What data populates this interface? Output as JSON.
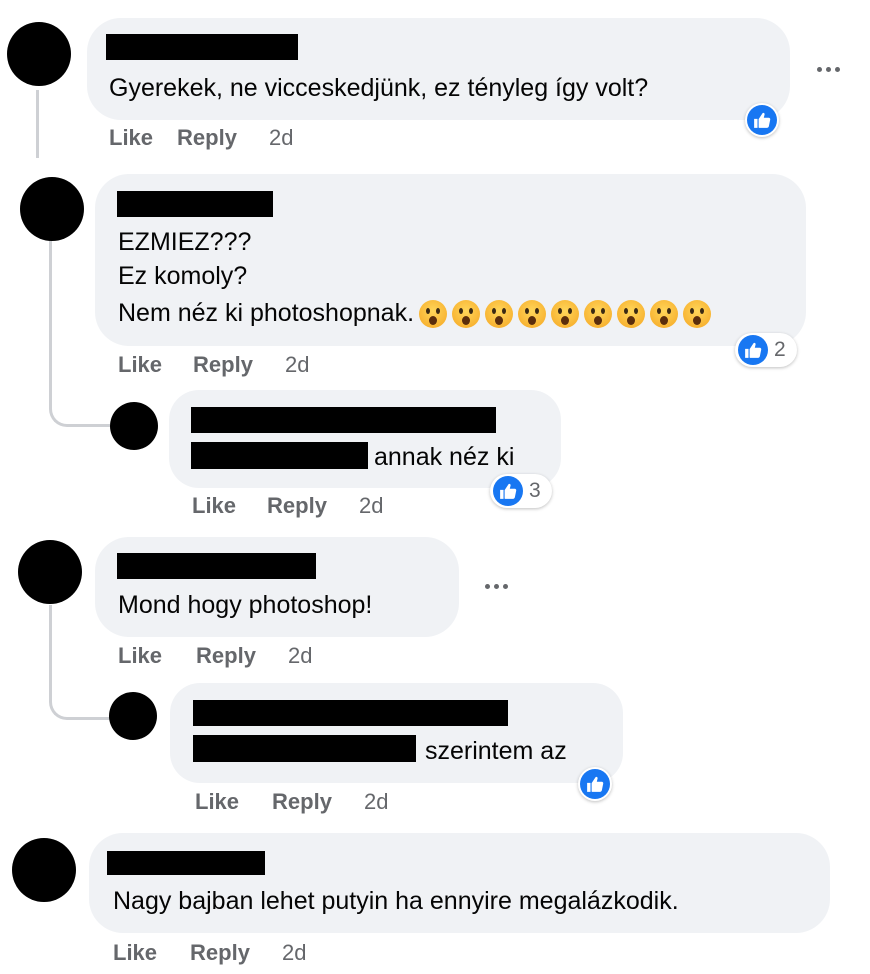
{
  "comments": [
    {
      "text": [
        "Gyerekek, ne vicceskedjünk, ez tényleg így volt?"
      ],
      "like": "Like",
      "reply": "Reply",
      "time": "2d",
      "reaction_count": ""
    },
    {
      "text": [
        "EZMIEZ???",
        "Ez komoly?",
        "Nem néz ki photoshopnak."
      ],
      "emoji_count": 9,
      "like": "Like",
      "reply": "Reply",
      "time": "2d",
      "reaction_count": "2"
    },
    {
      "text": [
        "annak néz ki"
      ],
      "like": "Like",
      "reply": "Reply",
      "time": "2d",
      "reaction_count": "3"
    },
    {
      "text": [
        "Mond hogy photoshop!"
      ],
      "like": "Like",
      "reply": "Reply",
      "time": "2d",
      "reaction_count": ""
    },
    {
      "text": [
        "szerintem az"
      ],
      "like": "Like",
      "reply": "Reply",
      "time": "2d",
      "reaction_count": ""
    },
    {
      "text": [
        "Nagy bajban lehet putyin ha ennyire megalázkodik."
      ],
      "like": "Like",
      "reply": "Reply",
      "time": "2d",
      "reaction_count": ""
    }
  ],
  "icons": {
    "reaction": "like-thumb-icon",
    "emoji": "hushed-face-emoji",
    "more": "more-options-icon"
  },
  "colors": {
    "like_blue": "#1877f2",
    "bubble": "#f0f2f5",
    "meta_gray": "#65676b"
  }
}
